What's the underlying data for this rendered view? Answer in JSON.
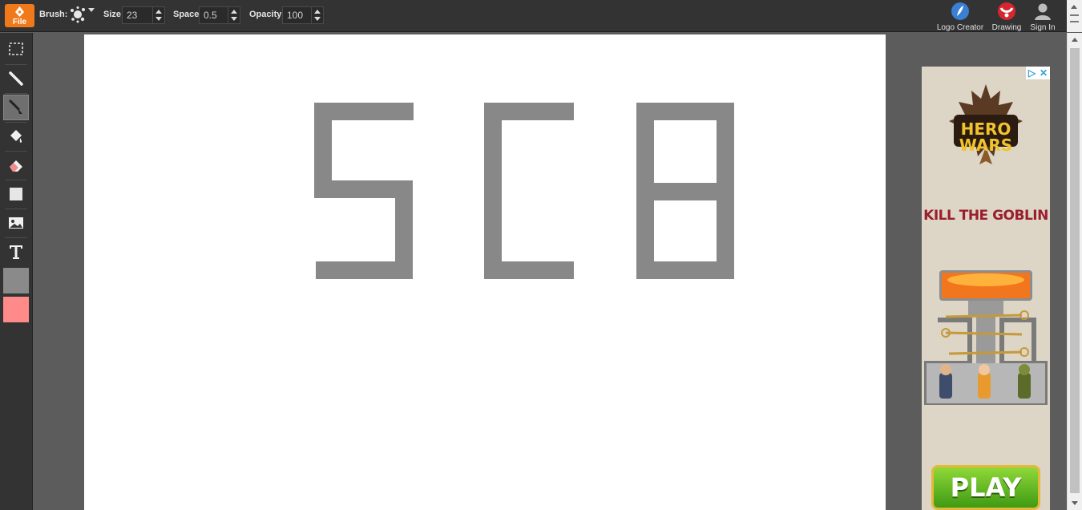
{
  "toolbar": {
    "file_label": "File",
    "brush_label": "Brush:",
    "brush_icon": "splatter-brush-icon",
    "size_label": "Size:",
    "size_value": "23",
    "space_label": "Space:",
    "space_value": "0.5",
    "opacity_label": "Opacity:",
    "opacity_value": "100",
    "accent_color": "#f07a1a"
  },
  "header_links": [
    {
      "label": "Logo Creator",
      "icon": "feather-icon"
    },
    {
      "label": "Drawing",
      "icon": "drawing-icon"
    },
    {
      "label": "Sign In",
      "icon": "user-icon"
    }
  ],
  "tools": [
    {
      "name": "select-tool",
      "icon": "marquee-select-icon"
    },
    {
      "name": "pencil-tool",
      "icon": "pencil-icon"
    },
    {
      "name": "brush-tool",
      "icon": "brush-icon",
      "active": true
    },
    {
      "name": "fill-tool",
      "icon": "paint-bucket-icon"
    },
    {
      "name": "eraser-tool",
      "icon": "eraser-icon"
    },
    {
      "name": "shape-tool",
      "icon": "square-shape-icon"
    },
    {
      "name": "image-tool",
      "icon": "image-icon"
    },
    {
      "name": "text-tool",
      "icon": "text-icon"
    }
  ],
  "colors": {
    "primary": "#8a8a8a",
    "secondary": "#ff8a8a",
    "stroke": "#888888"
  },
  "canvas": {
    "drawn_text": "SC8"
  },
  "ad": {
    "logo_text": "HERO WARS",
    "tagline": "KILL THE GOBLIN",
    "button_label": "PLAY"
  }
}
